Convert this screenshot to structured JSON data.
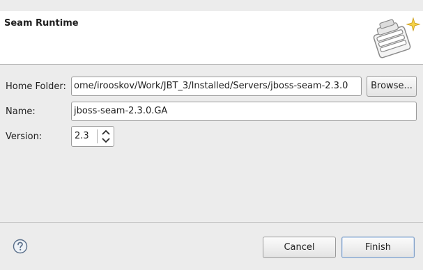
{
  "banner": {
    "title": "Seam Runtime",
    "icon": "seam-runtime-wizard-icon"
  },
  "form": {
    "home_folder": {
      "label": "Home Folder:",
      "value": "ome/irooskov/Work/JBT_3/Installed/Servers/jboss-seam-2.3.0"
    },
    "browse_label": "Browse...",
    "name": {
      "label": "Name:",
      "value": "jboss-seam-2.3.0.GA"
    },
    "version": {
      "label": "Version:",
      "value": "2.3"
    }
  },
  "footer": {
    "help_icon": "help-icon",
    "cancel_label": "Cancel",
    "finish_label": "Finish"
  }
}
